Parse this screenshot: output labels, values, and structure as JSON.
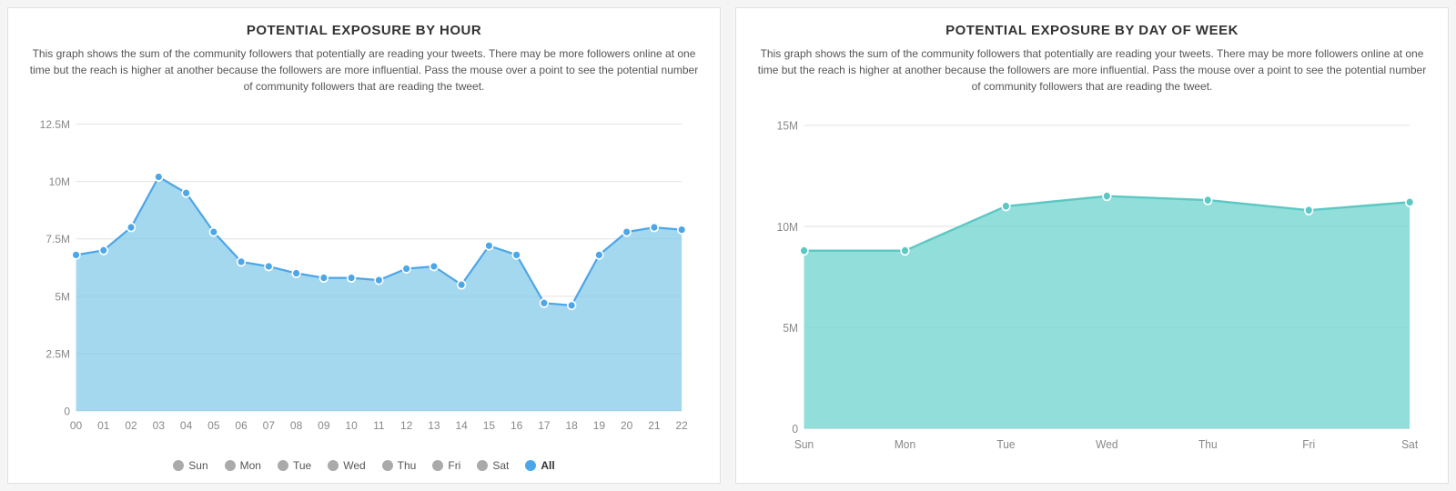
{
  "panel1": {
    "title": "POTENTIAL EXPOSURE BY HOUR",
    "desc": "This graph shows the sum of the community followers that potentially are reading your tweets. There may be more followers online at one time but the reach is higher at another because the followers are more influential. Pass the mouse over a point to see the potential number of community followers that are reading the tweet.",
    "yLabels": [
      "0",
      "2.5M",
      "5M",
      "7.5M",
      "10M",
      "12.5M"
    ],
    "xLabels": [
      "00",
      "01",
      "02",
      "03",
      "04",
      "05",
      "06",
      "07",
      "08",
      "09",
      "10",
      "11",
      "12",
      "13",
      "14",
      "15",
      "16",
      "17",
      "18",
      "19",
      "20",
      "21",
      "22"
    ],
    "legend": [
      {
        "label": "Sun",
        "active": false
      },
      {
        "label": "Mon",
        "active": false
      },
      {
        "label": "Tue",
        "active": false
      },
      {
        "label": "Wed",
        "active": false
      },
      {
        "label": "Thu",
        "active": false
      },
      {
        "label": "Fri",
        "active": false
      },
      {
        "label": "Sat",
        "active": false
      },
      {
        "label": "All",
        "active": true
      }
    ],
    "dataPoints": [
      6.8,
      7.0,
      8.0,
      10.2,
      9.5,
      7.8,
      6.5,
      6.3,
      6.0,
      5.8,
      5.8,
      5.7,
      6.2,
      6.3,
      5.5,
      7.2,
      6.8,
      4.7,
      4.6,
      6.8,
      7.8,
      8.0,
      7.9
    ],
    "maxY": 12.5
  },
  "panel2": {
    "title": "POTENTIAL EXPOSURE BY DAY OF WEEK",
    "desc": "This graph shows the sum of the community followers that potentially are reading your tweets. There may be more followers online at one time but the reach is higher at another because the followers are more influential. Pass the mouse over a point to see the potential number of community followers that are reading the tweet.",
    "yLabels": [
      "0",
      "5M",
      "10M",
      "15M"
    ],
    "xLabels": [
      "Sun",
      "Mon",
      "Tue",
      "Wed",
      "Thu",
      "Fri",
      "Sat"
    ],
    "dataPoints": [
      8.8,
      8.8,
      11.0,
      11.5,
      11.3,
      10.8,
      11.2
    ],
    "maxY": 15
  }
}
